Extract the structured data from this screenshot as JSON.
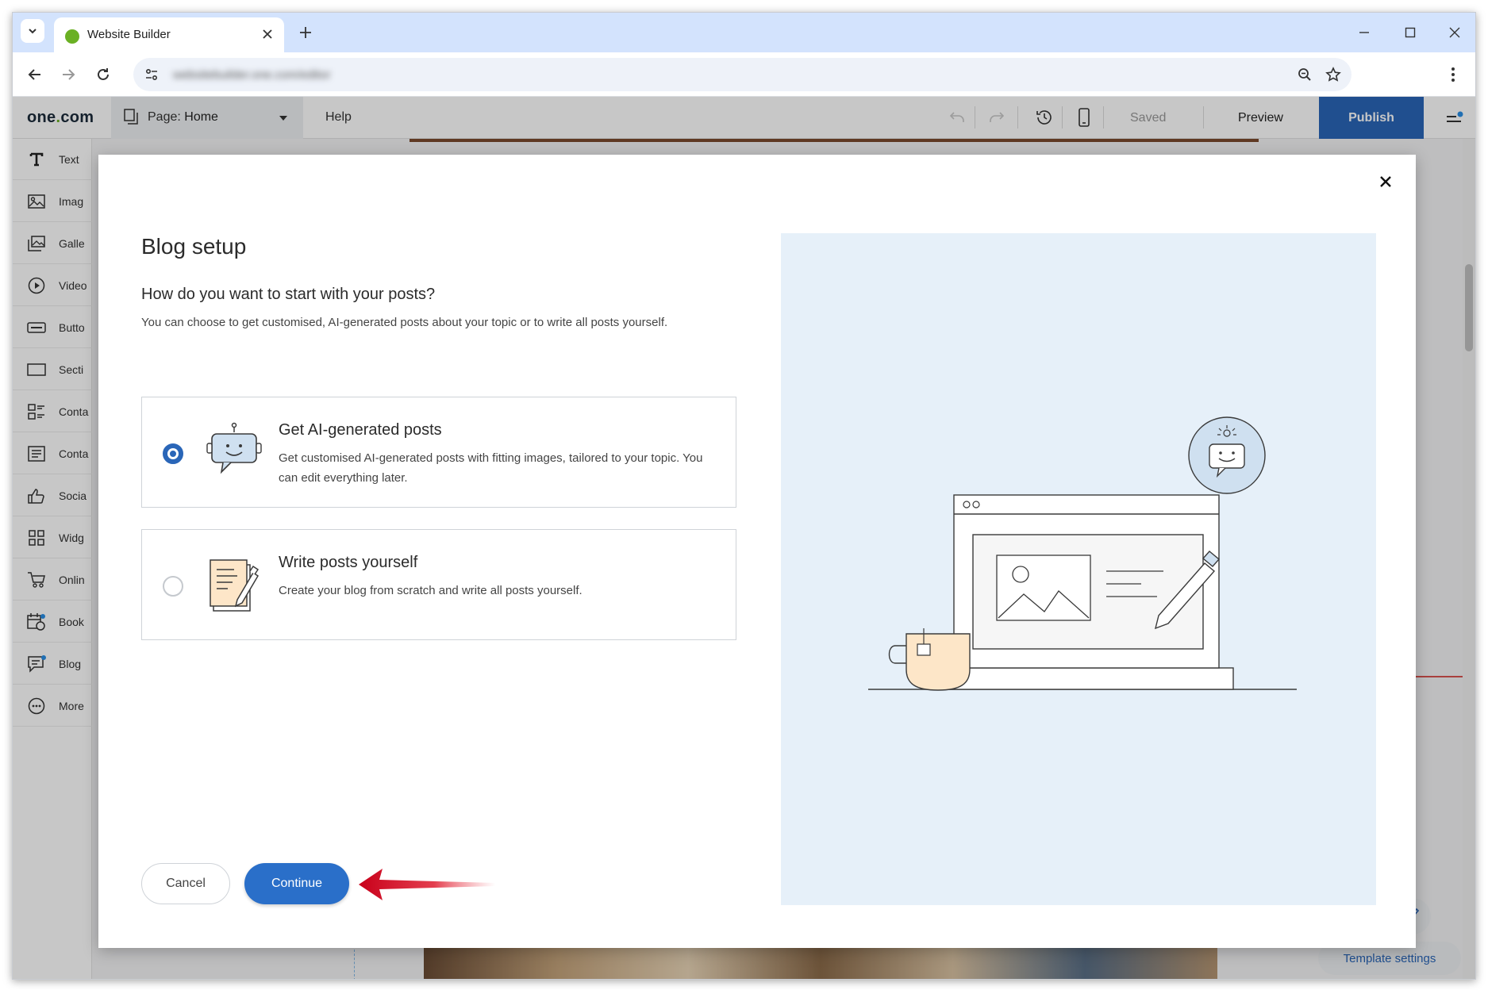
{
  "browser": {
    "tab_title": "Website Builder",
    "url": "websitebuilder.one.com/editor"
  },
  "app": {
    "logo_text": "one",
    "logo_dot": ".",
    "logo_suffix": "com",
    "page_prefix": "Page:",
    "page_name": "Home",
    "help_label": "Help",
    "saved_label": "Saved",
    "preview_label": "Preview",
    "publish_label": "Publish",
    "template_settings_label": "Template settings"
  },
  "sidebar": {
    "items": [
      {
        "label": "Text",
        "icon": "text-icon"
      },
      {
        "label": "Imag",
        "icon": "image-icon"
      },
      {
        "label": "Galle",
        "icon": "gallery-icon"
      },
      {
        "label": "Video",
        "icon": "video-icon"
      },
      {
        "label": "Butto",
        "icon": "button-icon"
      },
      {
        "label": "Secti",
        "icon": "section-icon"
      },
      {
        "label": "Conta",
        "icon": "container-icon"
      },
      {
        "label": "Conta",
        "icon": "contact-form-icon"
      },
      {
        "label": "Socia",
        "icon": "social-icon"
      },
      {
        "label": "Widg",
        "icon": "widgets-icon"
      },
      {
        "label": "Onlin",
        "icon": "cart-icon"
      },
      {
        "label": "Book",
        "icon": "booking-icon"
      },
      {
        "label": "Blog",
        "icon": "blog-icon"
      },
      {
        "label": "More",
        "icon": "more-icon"
      }
    ]
  },
  "modal": {
    "title": "Blog setup",
    "question": "How do you want to start with your posts?",
    "description": "You can choose to get customised, AI-generated posts about your topic or to write all posts yourself.",
    "options": [
      {
        "title": "Get AI-generated posts",
        "description": "Get customised AI-generated posts with fitting images, tailored to your topic. You can edit everything later.",
        "selected": true,
        "icon": "robot-chat-icon"
      },
      {
        "title": "Write posts yourself",
        "description": "Create your blog from scratch and write all posts yourself.",
        "selected": false,
        "icon": "notepad-pencil-icon"
      }
    ],
    "cancel_label": "Cancel",
    "continue_label": "Continue"
  },
  "colors": {
    "accent": "#2a66b8",
    "continue_bg": "#2a6fc9",
    "illustration_bg": "#e6f0f9",
    "annotation_arrow": "#d0021b"
  }
}
